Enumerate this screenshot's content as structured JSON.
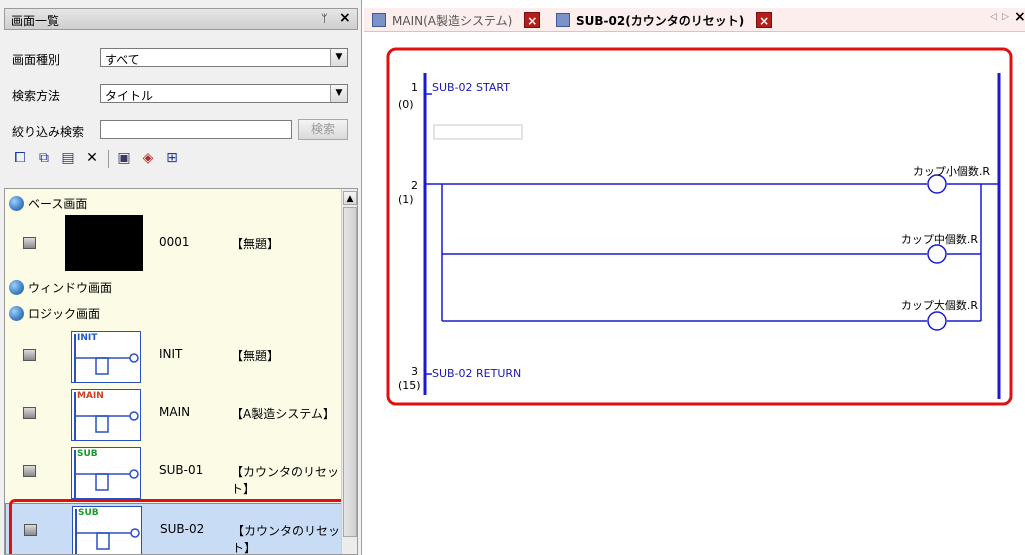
{
  "left_panel": {
    "title": "画面一覧",
    "pin_icon": "pin-icon",
    "close_glyph": "×",
    "screen_type_label": "画面種別",
    "screen_type_value": "すべて",
    "search_method_label": "検索方法",
    "search_method_value": "タイトル",
    "filter_label": "絞り込み検索",
    "filter_value": "",
    "filter_button": "検索",
    "toolbar_icons": [
      "new-screen-icon",
      "copy-screen-icon",
      "paste-screen-icon",
      "delete-icon",
      "screen-icon",
      "parts-icon",
      "import-icon"
    ],
    "groups": {
      "base": "ベース画面",
      "window": "ウィンドウ画面",
      "logic": "ロジック画面"
    },
    "screens": [
      {
        "number": "0001",
        "title": "【無題】",
        "thumb_tag": ""
      },
      {
        "number": "INIT",
        "title": "【無題】",
        "thumb_tag": "INIT"
      },
      {
        "number": "MAIN",
        "title": "【A製造システム】",
        "thumb_tag": "MAIN"
      },
      {
        "number": "SUB-01",
        "title": "【カウンタのリセット】",
        "thumb_tag": "SUB"
      },
      {
        "number": "SUB-02",
        "title": "【カウンタのリセット】",
        "thumb_tag": "SUB"
      }
    ],
    "colors": {
      "tree_bg": "#fbfbe6",
      "selected": "#c9dcf5",
      "init_tag": "#1a5ad0",
      "main_tag": "#d04020",
      "sub_tag": "#1a9a2a"
    }
  },
  "tabs": [
    {
      "label": "MAIN(A製造システム)",
      "active": false
    },
    {
      "label": "SUB-02(カウンタのリセット)",
      "active": true
    }
  ],
  "tab_close_glyph": "×",
  "tab_scroll_left": "◁",
  "tab_scroll_right": "▷",
  "ladder": {
    "rungs": [
      {
        "num": "1",
        "step": "(0)",
        "text": "SUB-02 START"
      },
      {
        "num": "2",
        "step": "(1)",
        "text": ""
      },
      {
        "num": "3",
        "step": "(15)",
        "text": "SUB-02 RETURN"
      }
    ],
    "coils": [
      "カップ小個数.R",
      "カップ中個数.R",
      "カップ大個数.R"
    ],
    "colors": {
      "rail": "#1a1ad0",
      "highlight": "#e01010"
    }
  }
}
